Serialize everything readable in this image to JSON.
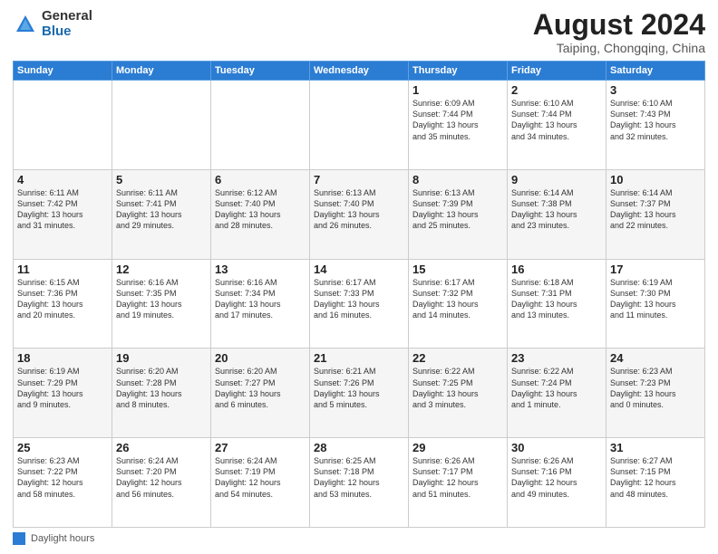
{
  "header": {
    "logo_general": "General",
    "logo_blue": "Blue",
    "main_title": "August 2024",
    "subtitle": "Taiping, Chongqing, China"
  },
  "days_of_week": [
    "Sunday",
    "Monday",
    "Tuesday",
    "Wednesday",
    "Thursday",
    "Friday",
    "Saturday"
  ],
  "footer_label": "Daylight hours",
  "weeks": [
    [
      {
        "day": "",
        "info": ""
      },
      {
        "day": "",
        "info": ""
      },
      {
        "day": "",
        "info": ""
      },
      {
        "day": "",
        "info": ""
      },
      {
        "day": "1",
        "info": "Sunrise: 6:09 AM\nSunset: 7:44 PM\nDaylight: 13 hours\nand 35 minutes."
      },
      {
        "day": "2",
        "info": "Sunrise: 6:10 AM\nSunset: 7:44 PM\nDaylight: 13 hours\nand 34 minutes."
      },
      {
        "day": "3",
        "info": "Sunrise: 6:10 AM\nSunset: 7:43 PM\nDaylight: 13 hours\nand 32 minutes."
      }
    ],
    [
      {
        "day": "4",
        "info": "Sunrise: 6:11 AM\nSunset: 7:42 PM\nDaylight: 13 hours\nand 31 minutes."
      },
      {
        "day": "5",
        "info": "Sunrise: 6:11 AM\nSunset: 7:41 PM\nDaylight: 13 hours\nand 29 minutes."
      },
      {
        "day": "6",
        "info": "Sunrise: 6:12 AM\nSunset: 7:40 PM\nDaylight: 13 hours\nand 28 minutes."
      },
      {
        "day": "7",
        "info": "Sunrise: 6:13 AM\nSunset: 7:40 PM\nDaylight: 13 hours\nand 26 minutes."
      },
      {
        "day": "8",
        "info": "Sunrise: 6:13 AM\nSunset: 7:39 PM\nDaylight: 13 hours\nand 25 minutes."
      },
      {
        "day": "9",
        "info": "Sunrise: 6:14 AM\nSunset: 7:38 PM\nDaylight: 13 hours\nand 23 minutes."
      },
      {
        "day": "10",
        "info": "Sunrise: 6:14 AM\nSunset: 7:37 PM\nDaylight: 13 hours\nand 22 minutes."
      }
    ],
    [
      {
        "day": "11",
        "info": "Sunrise: 6:15 AM\nSunset: 7:36 PM\nDaylight: 13 hours\nand 20 minutes."
      },
      {
        "day": "12",
        "info": "Sunrise: 6:16 AM\nSunset: 7:35 PM\nDaylight: 13 hours\nand 19 minutes."
      },
      {
        "day": "13",
        "info": "Sunrise: 6:16 AM\nSunset: 7:34 PM\nDaylight: 13 hours\nand 17 minutes."
      },
      {
        "day": "14",
        "info": "Sunrise: 6:17 AM\nSunset: 7:33 PM\nDaylight: 13 hours\nand 16 minutes."
      },
      {
        "day": "15",
        "info": "Sunrise: 6:17 AM\nSunset: 7:32 PM\nDaylight: 13 hours\nand 14 minutes."
      },
      {
        "day": "16",
        "info": "Sunrise: 6:18 AM\nSunset: 7:31 PM\nDaylight: 13 hours\nand 13 minutes."
      },
      {
        "day": "17",
        "info": "Sunrise: 6:19 AM\nSunset: 7:30 PM\nDaylight: 13 hours\nand 11 minutes."
      }
    ],
    [
      {
        "day": "18",
        "info": "Sunrise: 6:19 AM\nSunset: 7:29 PM\nDaylight: 13 hours\nand 9 minutes."
      },
      {
        "day": "19",
        "info": "Sunrise: 6:20 AM\nSunset: 7:28 PM\nDaylight: 13 hours\nand 8 minutes."
      },
      {
        "day": "20",
        "info": "Sunrise: 6:20 AM\nSunset: 7:27 PM\nDaylight: 13 hours\nand 6 minutes."
      },
      {
        "day": "21",
        "info": "Sunrise: 6:21 AM\nSunset: 7:26 PM\nDaylight: 13 hours\nand 5 minutes."
      },
      {
        "day": "22",
        "info": "Sunrise: 6:22 AM\nSunset: 7:25 PM\nDaylight: 13 hours\nand 3 minutes."
      },
      {
        "day": "23",
        "info": "Sunrise: 6:22 AM\nSunset: 7:24 PM\nDaylight: 13 hours\nand 1 minute."
      },
      {
        "day": "24",
        "info": "Sunrise: 6:23 AM\nSunset: 7:23 PM\nDaylight: 13 hours\nand 0 minutes."
      }
    ],
    [
      {
        "day": "25",
        "info": "Sunrise: 6:23 AM\nSunset: 7:22 PM\nDaylight: 12 hours\nand 58 minutes."
      },
      {
        "day": "26",
        "info": "Sunrise: 6:24 AM\nSunset: 7:20 PM\nDaylight: 12 hours\nand 56 minutes."
      },
      {
        "day": "27",
        "info": "Sunrise: 6:24 AM\nSunset: 7:19 PM\nDaylight: 12 hours\nand 54 minutes."
      },
      {
        "day": "28",
        "info": "Sunrise: 6:25 AM\nSunset: 7:18 PM\nDaylight: 12 hours\nand 53 minutes."
      },
      {
        "day": "29",
        "info": "Sunrise: 6:26 AM\nSunset: 7:17 PM\nDaylight: 12 hours\nand 51 minutes."
      },
      {
        "day": "30",
        "info": "Sunrise: 6:26 AM\nSunset: 7:16 PM\nDaylight: 12 hours\nand 49 minutes."
      },
      {
        "day": "31",
        "info": "Sunrise: 6:27 AM\nSunset: 7:15 PM\nDaylight: 12 hours\nand 48 minutes."
      }
    ]
  ]
}
